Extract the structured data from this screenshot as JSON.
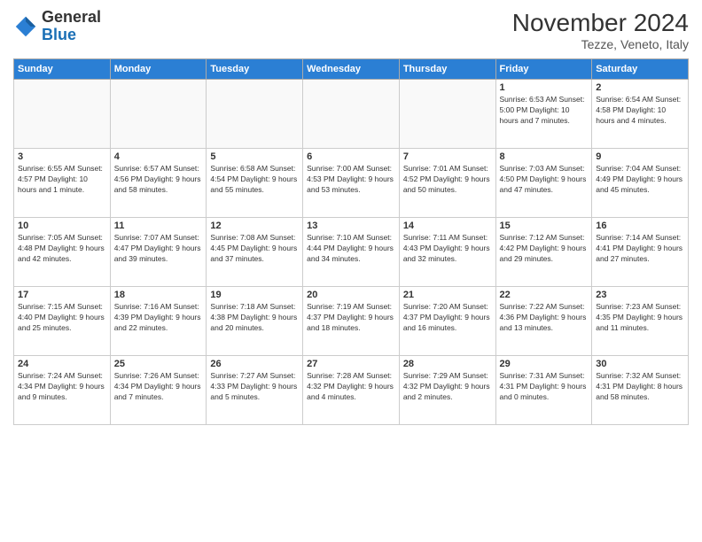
{
  "header": {
    "logo_general": "General",
    "logo_blue": "Blue",
    "month_title": "November 2024",
    "location": "Tezze, Veneto, Italy"
  },
  "weekdays": [
    "Sunday",
    "Monday",
    "Tuesday",
    "Wednesday",
    "Thursday",
    "Friday",
    "Saturday"
  ],
  "weeks": [
    [
      {
        "day": "",
        "info": ""
      },
      {
        "day": "",
        "info": ""
      },
      {
        "day": "",
        "info": ""
      },
      {
        "day": "",
        "info": ""
      },
      {
        "day": "",
        "info": ""
      },
      {
        "day": "1",
        "info": "Sunrise: 6:53 AM\nSunset: 5:00 PM\nDaylight: 10 hours\nand 7 minutes."
      },
      {
        "day": "2",
        "info": "Sunrise: 6:54 AM\nSunset: 4:58 PM\nDaylight: 10 hours\nand 4 minutes."
      }
    ],
    [
      {
        "day": "3",
        "info": "Sunrise: 6:55 AM\nSunset: 4:57 PM\nDaylight: 10 hours\nand 1 minute."
      },
      {
        "day": "4",
        "info": "Sunrise: 6:57 AM\nSunset: 4:56 PM\nDaylight: 9 hours\nand 58 minutes."
      },
      {
        "day": "5",
        "info": "Sunrise: 6:58 AM\nSunset: 4:54 PM\nDaylight: 9 hours\nand 55 minutes."
      },
      {
        "day": "6",
        "info": "Sunrise: 7:00 AM\nSunset: 4:53 PM\nDaylight: 9 hours\nand 53 minutes."
      },
      {
        "day": "7",
        "info": "Sunrise: 7:01 AM\nSunset: 4:52 PM\nDaylight: 9 hours\nand 50 minutes."
      },
      {
        "day": "8",
        "info": "Sunrise: 7:03 AM\nSunset: 4:50 PM\nDaylight: 9 hours\nand 47 minutes."
      },
      {
        "day": "9",
        "info": "Sunrise: 7:04 AM\nSunset: 4:49 PM\nDaylight: 9 hours\nand 45 minutes."
      }
    ],
    [
      {
        "day": "10",
        "info": "Sunrise: 7:05 AM\nSunset: 4:48 PM\nDaylight: 9 hours\nand 42 minutes."
      },
      {
        "day": "11",
        "info": "Sunrise: 7:07 AM\nSunset: 4:47 PM\nDaylight: 9 hours\nand 39 minutes."
      },
      {
        "day": "12",
        "info": "Sunrise: 7:08 AM\nSunset: 4:45 PM\nDaylight: 9 hours\nand 37 minutes."
      },
      {
        "day": "13",
        "info": "Sunrise: 7:10 AM\nSunset: 4:44 PM\nDaylight: 9 hours\nand 34 minutes."
      },
      {
        "day": "14",
        "info": "Sunrise: 7:11 AM\nSunset: 4:43 PM\nDaylight: 9 hours\nand 32 minutes."
      },
      {
        "day": "15",
        "info": "Sunrise: 7:12 AM\nSunset: 4:42 PM\nDaylight: 9 hours\nand 29 minutes."
      },
      {
        "day": "16",
        "info": "Sunrise: 7:14 AM\nSunset: 4:41 PM\nDaylight: 9 hours\nand 27 minutes."
      }
    ],
    [
      {
        "day": "17",
        "info": "Sunrise: 7:15 AM\nSunset: 4:40 PM\nDaylight: 9 hours\nand 25 minutes."
      },
      {
        "day": "18",
        "info": "Sunrise: 7:16 AM\nSunset: 4:39 PM\nDaylight: 9 hours\nand 22 minutes."
      },
      {
        "day": "19",
        "info": "Sunrise: 7:18 AM\nSunset: 4:38 PM\nDaylight: 9 hours\nand 20 minutes."
      },
      {
        "day": "20",
        "info": "Sunrise: 7:19 AM\nSunset: 4:37 PM\nDaylight: 9 hours\nand 18 minutes."
      },
      {
        "day": "21",
        "info": "Sunrise: 7:20 AM\nSunset: 4:37 PM\nDaylight: 9 hours\nand 16 minutes."
      },
      {
        "day": "22",
        "info": "Sunrise: 7:22 AM\nSunset: 4:36 PM\nDaylight: 9 hours\nand 13 minutes."
      },
      {
        "day": "23",
        "info": "Sunrise: 7:23 AM\nSunset: 4:35 PM\nDaylight: 9 hours\nand 11 minutes."
      }
    ],
    [
      {
        "day": "24",
        "info": "Sunrise: 7:24 AM\nSunset: 4:34 PM\nDaylight: 9 hours\nand 9 minutes."
      },
      {
        "day": "25",
        "info": "Sunrise: 7:26 AM\nSunset: 4:34 PM\nDaylight: 9 hours\nand 7 minutes."
      },
      {
        "day": "26",
        "info": "Sunrise: 7:27 AM\nSunset: 4:33 PM\nDaylight: 9 hours\nand 5 minutes."
      },
      {
        "day": "27",
        "info": "Sunrise: 7:28 AM\nSunset: 4:32 PM\nDaylight: 9 hours\nand 4 minutes."
      },
      {
        "day": "28",
        "info": "Sunrise: 7:29 AM\nSunset: 4:32 PM\nDaylight: 9 hours\nand 2 minutes."
      },
      {
        "day": "29",
        "info": "Sunrise: 7:31 AM\nSunset: 4:31 PM\nDaylight: 9 hours\nand 0 minutes."
      },
      {
        "day": "30",
        "info": "Sunrise: 7:32 AM\nSunset: 4:31 PM\nDaylight: 8 hours\nand 58 minutes."
      }
    ]
  ]
}
